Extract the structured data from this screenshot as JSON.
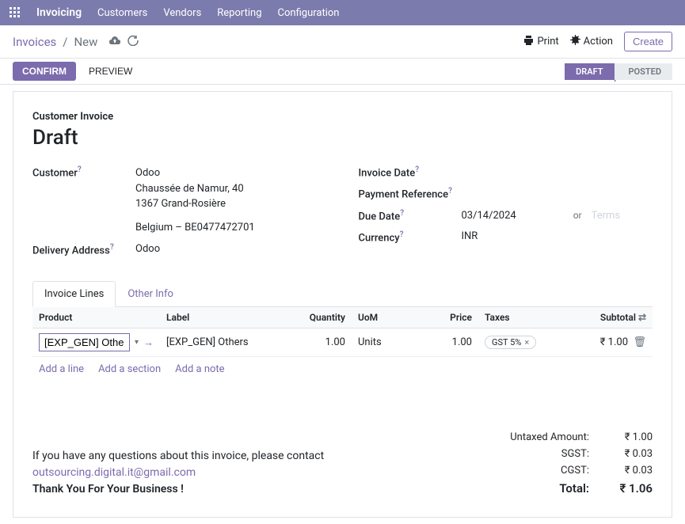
{
  "nav": {
    "brand": "Invoicing",
    "items": [
      "Customers",
      "Vendors",
      "Reporting",
      "Configuration"
    ]
  },
  "breadcrumb": {
    "root": "Invoices",
    "current": "New"
  },
  "cp": {
    "print": "Print",
    "action": "Action",
    "create": "Create"
  },
  "buttons": {
    "confirm": "CONFIRM",
    "preview": "PREVIEW"
  },
  "status": {
    "draft": "DRAFT",
    "posted": "POSTED"
  },
  "doc": {
    "subtitle": "Customer Invoice",
    "title": "Draft",
    "customer_label": "Customer",
    "customer_name": "Odoo",
    "addr1": "Chaussée de Namur, 40",
    "addr2": "1367 Grand-Rosière",
    "addr3": "Belgium – BE0477472701",
    "delivery_label": "Delivery Address",
    "delivery_value": "Odoo",
    "invoice_date_label": "Invoice Date",
    "payment_ref_label": "Payment Reference",
    "due_date_label": "Due Date",
    "due_date": "03/14/2024",
    "or": "or",
    "terms_placeholder": "Terms",
    "currency_label": "Currency",
    "currency": "INR"
  },
  "tabs": {
    "lines": "Invoice Lines",
    "other": "Other Info"
  },
  "cols": {
    "product": "Product",
    "label": "Label",
    "qty": "Quantity",
    "uom": "UoM",
    "price": "Price",
    "taxes": "Taxes",
    "subtotal": "Subtotal"
  },
  "line": {
    "product": "[EXP_GEN] Others",
    "label": "[EXP_GEN] Others",
    "qty": "1.00",
    "uom": "Units",
    "price": "1.00",
    "tax": "GST 5%",
    "subtotal": "₹ 1.00"
  },
  "add": {
    "line": "Add a line",
    "section": "Add a section",
    "note": "Add a note"
  },
  "footer": {
    "q_text": "If you have any questions about this invoice, please contact",
    "email": "outsourcing.digital.it@gmail.com",
    "thanks": "Thank You For Your Business !"
  },
  "totals": {
    "untaxed_label": "Untaxed Amount:",
    "untaxed": "₹ 1.00",
    "sgst_label": "SGST:",
    "sgst": "₹ 0.03",
    "cgst_label": "CGST:",
    "cgst": "₹ 0.03",
    "total_label": "Total:",
    "total": "₹ 1.06"
  }
}
